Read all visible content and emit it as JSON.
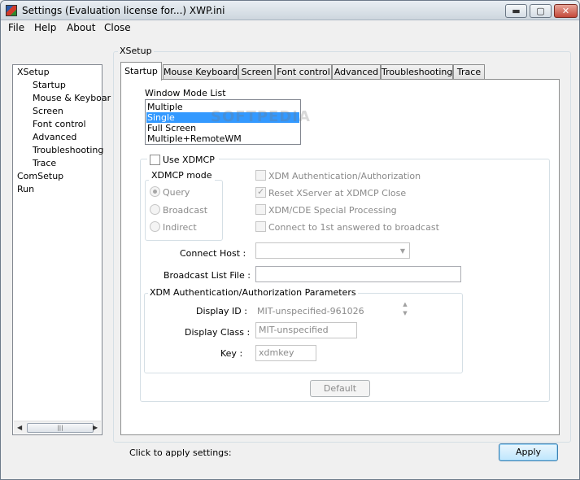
{
  "window": {
    "title": "Settings (Evaluation license for...) XWP.ini",
    "btn_min": "▬",
    "btn_max": "▢",
    "btn_close": "✕"
  },
  "menu": [
    "File",
    "Help",
    "About",
    "Close"
  ],
  "tree": {
    "items": [
      {
        "label": "XSetup",
        "level": 0
      },
      {
        "label": "Startup",
        "level": 1
      },
      {
        "label": "Mouse & Keyboar",
        "level": 1
      },
      {
        "label": "Screen",
        "level": 1
      },
      {
        "label": "Font control",
        "level": 1
      },
      {
        "label": "Advanced",
        "level": 1
      },
      {
        "label": "Troubleshooting",
        "level": 1
      },
      {
        "label": "Trace",
        "level": 1
      },
      {
        "label": "ComSetup",
        "level": 0
      },
      {
        "label": "Run",
        "level": 0
      }
    ],
    "scroll_left": "◀",
    "scroll_right": "▶",
    "scroll_grip": "|||"
  },
  "group_label": "XSetup",
  "tabs": [
    {
      "label": "Startup",
      "active": true
    },
    {
      "label": "Mouse  Keyboard",
      "active": false
    },
    {
      "label": "Screen",
      "active": false
    },
    {
      "label": "Font control",
      "active": false
    },
    {
      "label": "Advanced",
      "active": false
    },
    {
      "label": "Troubleshooting",
      "active": false
    },
    {
      "label": "Trace",
      "active": false
    }
  ],
  "startup": {
    "window_mode_label": "Window Mode List",
    "window_modes": [
      "Multiple",
      "Single",
      "Full Screen",
      "Multiple+RemoteWM"
    ],
    "selected_mode": "Single",
    "watermark": "SOFTPEDIA",
    "use_xdmcp_label": "Use XDMCP",
    "use_xdmcp_checked": false,
    "xdmcp_mode_label": "XDMCP mode",
    "xdmcp_modes": [
      "Query",
      "Broadcast",
      "Indirect"
    ],
    "xdmcp_mode_selected": "Query",
    "options": [
      {
        "label": "XDM Authentication/Authorization",
        "checked": false
      },
      {
        "label": "Reset XServer at XDMCP Close",
        "checked": true
      },
      {
        "label": "XDM/CDE Special Processing",
        "checked": false
      },
      {
        "label": "Connect to 1st answered to broadcast",
        "checked": false
      }
    ],
    "connect_host_label": "Connect Host :",
    "connect_host_value": "",
    "broadcast_label": "Broadcast List File :",
    "broadcast_value": "",
    "auth_group_label": "XDM Authentication/Authorization Parameters",
    "display_id_label": "Display ID :",
    "display_id_value": "MIT-unspecified-961026",
    "display_class_label": "Display Class :",
    "display_class_value": "MIT-unspecified",
    "key_label": "Key :",
    "key_value": "xdmkey",
    "default_button": "Default"
  },
  "status_text": "Click to apply settings:",
  "apply_button": "Apply"
}
